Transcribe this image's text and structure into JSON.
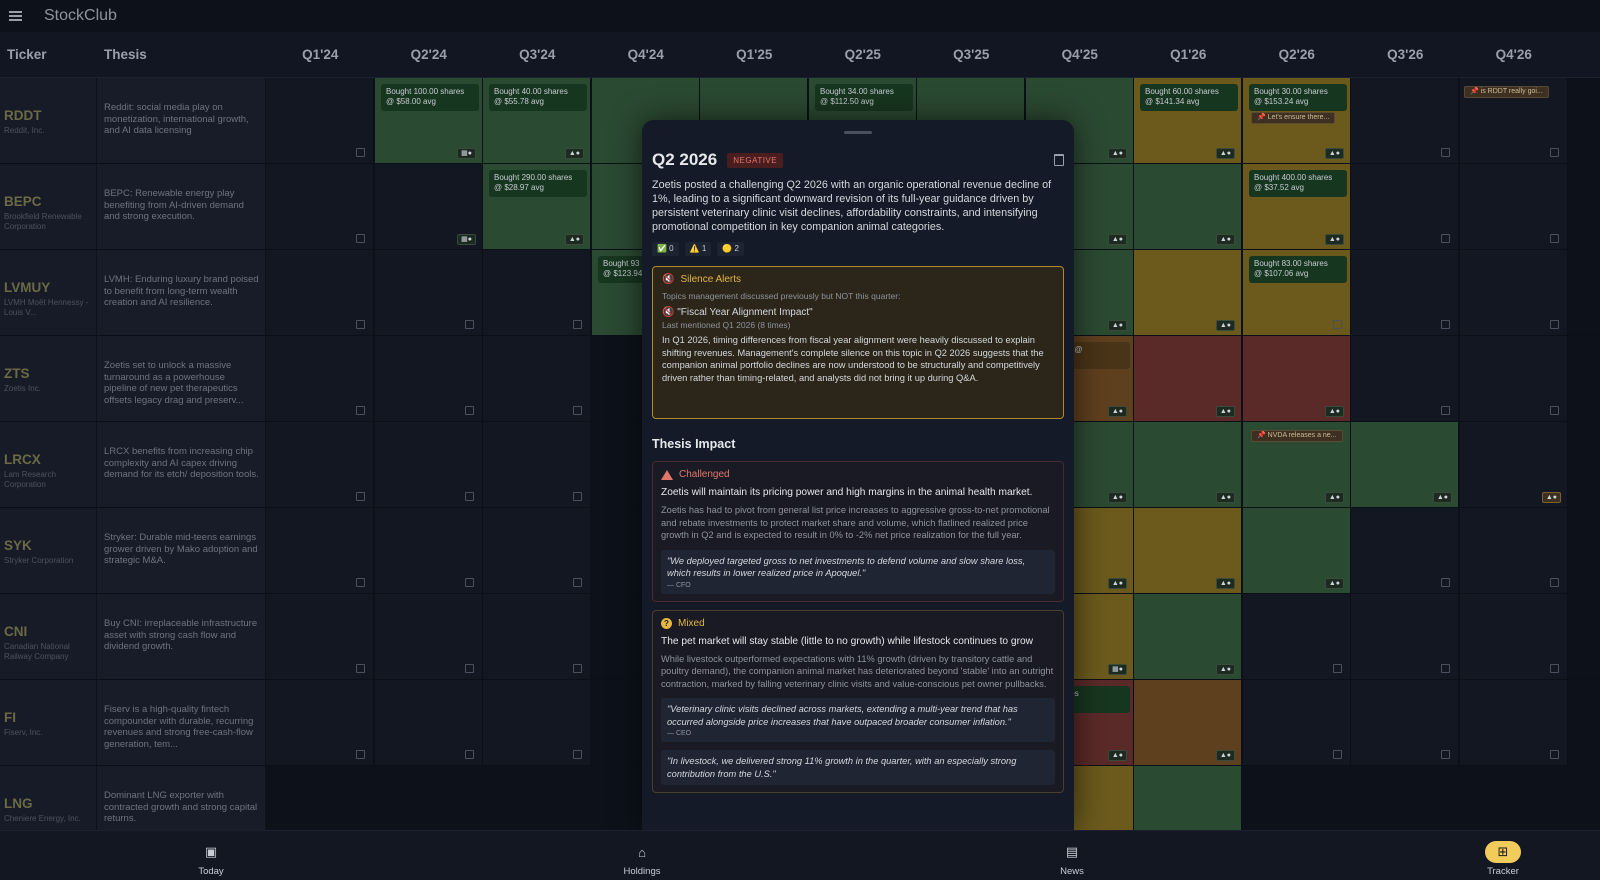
{
  "app": {
    "title": "StockClub"
  },
  "header": {
    "ticker": "Ticker",
    "thesis": "Thesis",
    "quarters": [
      "Q1'24",
      "Q2'24",
      "Q3'24",
      "Q4'24",
      "Q1'25",
      "Q2'25",
      "Q3'25",
      "Q4'25",
      "Q1'26",
      "Q2'26",
      "Q3'26",
      "Q4'26"
    ]
  },
  "rows": [
    {
      "ticker": "RDDT",
      "company": "Reddit, Inc.",
      "thesis": "Reddit: social media play on monetization, international growth, and AI data licensing",
      "buys": [
        "Bought 100.00 shares",
        "@ $58.00 avg",
        "Bought 40.00 shares",
        "@ $55.78 avg",
        "Bought 34.00 shares",
        "@ $112.50 avg",
        "Bought 60.00 shares",
        "@ $141.34 avg",
        "Bought 30.00 shares",
        "@ $153.24 avg"
      ],
      "pins": [
        "📌 Let's ensure there...",
        "📌 is RDDT really goi..."
      ]
    },
    {
      "ticker": "BEPC",
      "company": "Brookfield Renewable Corporation",
      "thesis": "BEPC: Renewable energy play benefiting from AI-driven demand and strong execution.",
      "buys": [
        "Bought 290.00 shares",
        "@ $28.97 avg",
        "Bought 400.00 shares",
        "@ $37.52 avg"
      ]
    },
    {
      "ticker": "LVMUY",
      "company": "LVMH Moët Hennessy - Louis V...",
      "thesis": "LVMH: Enduring luxury brand poised to benefit from long-term wealth creation and AI resilience.",
      "buys": [
        "Bought 93",
        "@ $123.94",
        "Bought 83.00 shares",
        "@ $107.06 avg"
      ]
    },
    {
      "ticker": "ZTS",
      "company": "Zoetis Inc.",
      "thesis": "Zoetis set to unlock a massive turnaround as a powerhouse pipeline of new pet therapeutics offsets legacy drag and preserv...",
      "buys": [
        "23 shares @",
        "vg"
      ]
    },
    {
      "ticker": "LRCX",
      "company": "Lam Research Corporation",
      "thesis": "LRCX benefits from increasing chip complexity and AI capex driving demand for its etch/ deposition tools.",
      "pins": [
        "📌 NVDA releases a ne..."
      ]
    },
    {
      "ticker": "SYK",
      "company": "Stryker Corporation",
      "thesis": "Stryker: Durable mid-teens earnings grower driven by Mako adoption and strategic M&A."
    },
    {
      "ticker": "CNI",
      "company": "Canadian National Railway Company",
      "thesis": "Buy CNI: irreplaceable infrastructure asset with strong cash flow and dividend growth."
    },
    {
      "ticker": "FI",
      "company": "Fiserv, Inc.",
      "thesis": "Fiserv is a high-quality fintech compounder with durable, recurring revenues and strong free-cash-flow generation, tem...",
      "buys": [
        "2.00 shares",
        "0 avg"
      ]
    },
    {
      "ticker": "LNG",
      "company": "Cheniere Energy, Inc.",
      "thesis": "Dominant LNG exporter with contracted growth and strong capital returns."
    }
  ],
  "badges": {
    "warn": "▲●",
    "chart": "▦●",
    "amber": "▲●"
  },
  "panel": {
    "title": "Q2 2026",
    "sentiment": "NEGATIVE",
    "summary": "Zoetis posted a challenging Q2 2026 with an organic operational revenue decline of 1%, leading to a significant downward revision of its full-year guidance driven by persistent veterinary clinic visit declines, affordability constraints, and intensifying promotional competition in key companion animal categories.",
    "counts": [
      "✅ 0",
      "⚠️ 1",
      "🟡 2"
    ],
    "silence": {
      "title": "Silence Alerts",
      "subtitle": "Topics management discussed previously but NOT this quarter:",
      "topic": "\"Fiscal Year Alignment Impact\"",
      "last": "Last mentioned Q1 2026 (8 times)",
      "body": "In Q1 2026, timing differences from fiscal year alignment were heavily discussed to explain shifting revenues. Management's complete silence on this topic in Q2 2026 suggests that the companion animal portfolio declines are now understood to be structurally and competitively driven rather than timing-related, and analysts did not bring it up during Q&A."
    },
    "impact_title": "Thesis Impact",
    "impacts": [
      {
        "status": "Challenged",
        "claim": "Zoetis will maintain its pricing power and high margins in the animal health market.",
        "desc": "Zoetis has had to pivot from general list price increases to aggressive gross-to-net promotional and rebate investments to protect market share and volume, which flatlined realized price growth in Q2 and is expected to result in 0% to -2% net price realization for the full year.",
        "quotes": [
          {
            "text": "\"We deployed targeted gross to net investments to defend volume and slow share loss, which results in lower realized price in Apoquel.\"",
            "by": "— CFO"
          }
        ]
      },
      {
        "status": "Mixed",
        "claim": "The pet market will stay stable (little to no growth) while lifestock continues to grow",
        "desc": "While livestock outperformed expectations with 11% growth (driven by transitory cattle and poultry demand), the companion animal market has deteriorated beyond 'stable' into an outright contraction, marked by falling veterinary clinic visits and value-conscious pet owner pullbacks.",
        "quotes": [
          {
            "text": "\"Veterinary clinic visits declined across markets, extending a multi-year trend that has occurred alongside price increases that have outpaced broader consumer inflation.\"",
            "by": "— CEO"
          },
          {
            "text": "\"In livestock, we delivered strong 11% growth in the quarter, with an especially strong contribution from the U.S.\"",
            "by": ""
          }
        ]
      }
    ]
  },
  "nav": [
    {
      "label": "Today",
      "icon": "calendar-icon",
      "glyph": "▣"
    },
    {
      "label": "Holdings",
      "icon": "bank-icon",
      "glyph": "⌂"
    },
    {
      "label": "News",
      "icon": "newspaper-icon",
      "glyph": "▤"
    },
    {
      "label": "Tracker",
      "icon": "grid-icon",
      "glyph": "⊞"
    }
  ],
  "colors": {
    "green": "#2b4a32",
    "yellow": "#6b5a1c",
    "red": "#5a2a28",
    "accent": "#f1cc5a"
  }
}
